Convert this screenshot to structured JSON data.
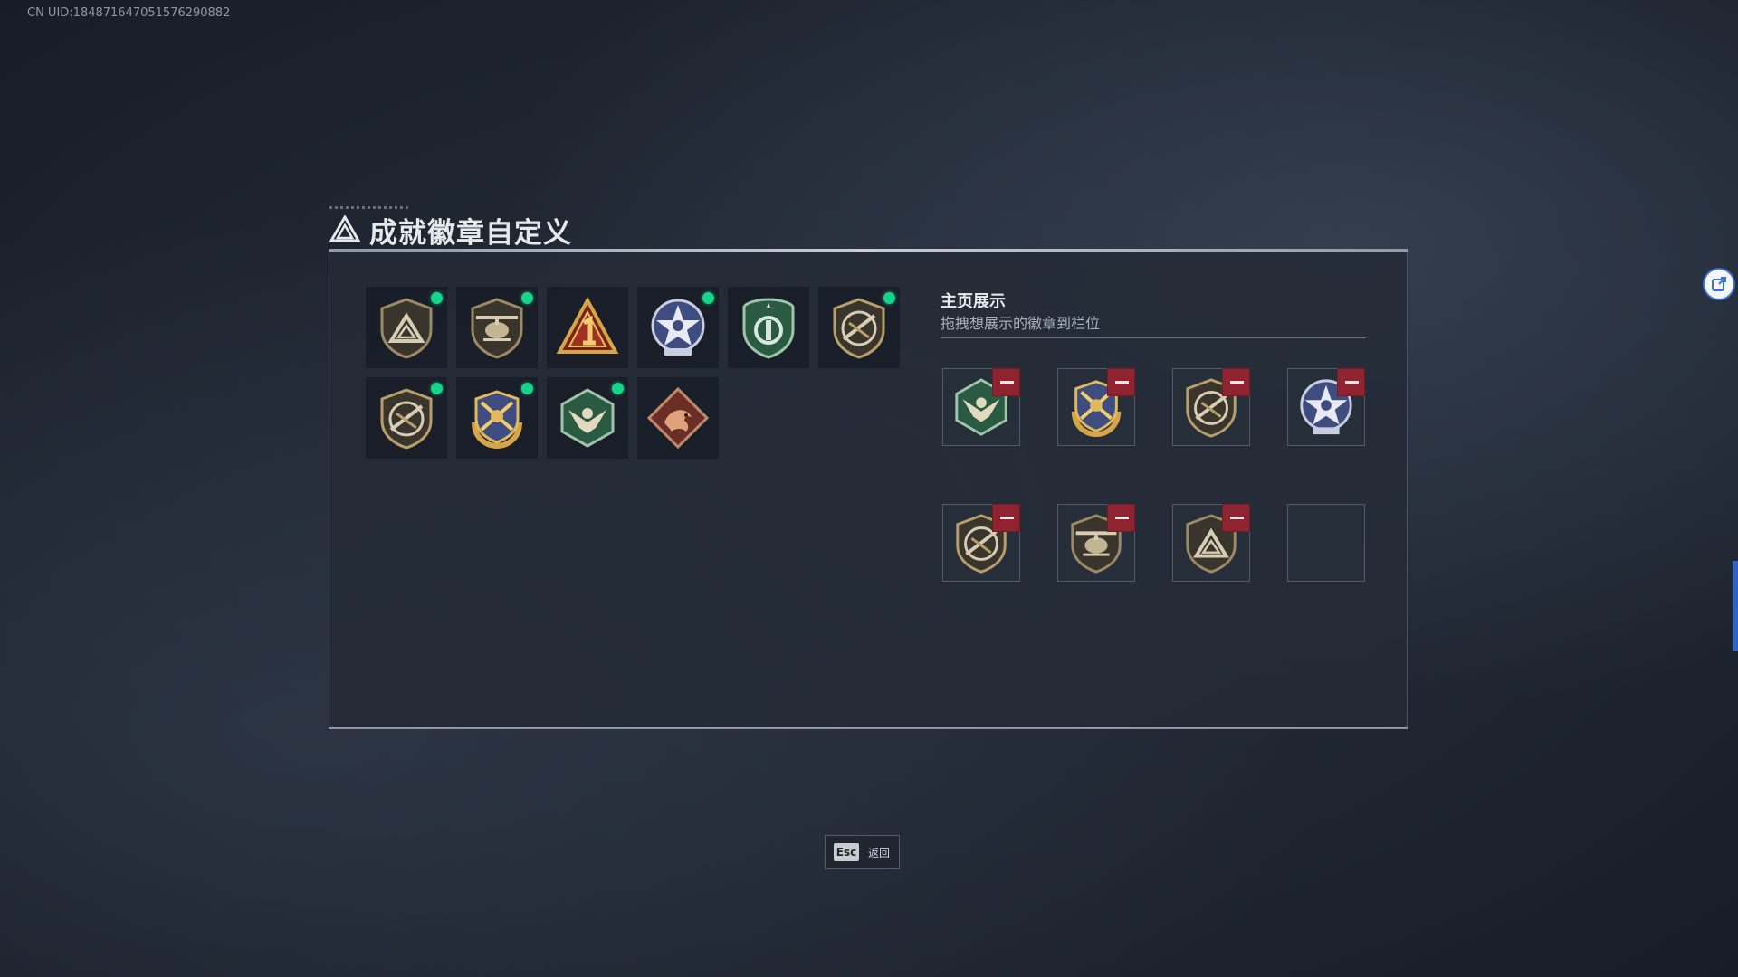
{
  "uid_text": "CN UID:184871647051576290882",
  "title": "成就徽章自定义",
  "owned_badges": [
    {
      "icon": "triangle-shield-badge-icon",
      "has_new": true
    },
    {
      "icon": "helicopter-shield-badge-icon",
      "has_new": true
    },
    {
      "icon": "gold-number-one-triangle-badge-icon",
      "has_new": false
    },
    {
      "icon": "blue-star-medal-badge-icon",
      "has_new": true
    },
    {
      "icon": "green-military-shield-badge-icon",
      "has_new": false
    },
    {
      "icon": "rifle-shield-badge-icon",
      "has_new": true
    },
    {
      "icon": "rifle-shield-badge-icon",
      "has_new": true
    },
    {
      "icon": "gold-crossed-rifles-wreath-badge-icon",
      "has_new": true
    },
    {
      "icon": "green-eagle-hexagon-badge-icon",
      "has_new": true
    },
    {
      "icon": "red-dragon-diamond-badge-icon",
      "has_new": false
    }
  ],
  "showcase": {
    "title": "主页展示",
    "subtitle": "拖拽想展示的徽章到栏位",
    "slots": [
      {
        "icon": "green-eagle-hexagon-badge-icon"
      },
      {
        "icon": "gold-crossed-rifles-wreath-badge-icon"
      },
      {
        "icon": "rifle-shield-badge-icon"
      },
      {
        "icon": "blue-star-medal-badge-icon"
      },
      {
        "icon": "rifle-shield-badge-icon"
      },
      {
        "icon": "helicopter-shield-badge-icon"
      },
      {
        "icon": "triangle-shield-badge-icon"
      },
      {
        "icon": ""
      }
    ]
  },
  "footer": {
    "esc_key": "Esc",
    "esc_label": "返回"
  },
  "colors": {
    "new_dot": "#16d48a",
    "remove_button": "#8f2330",
    "panel_bg": "#242b37"
  }
}
